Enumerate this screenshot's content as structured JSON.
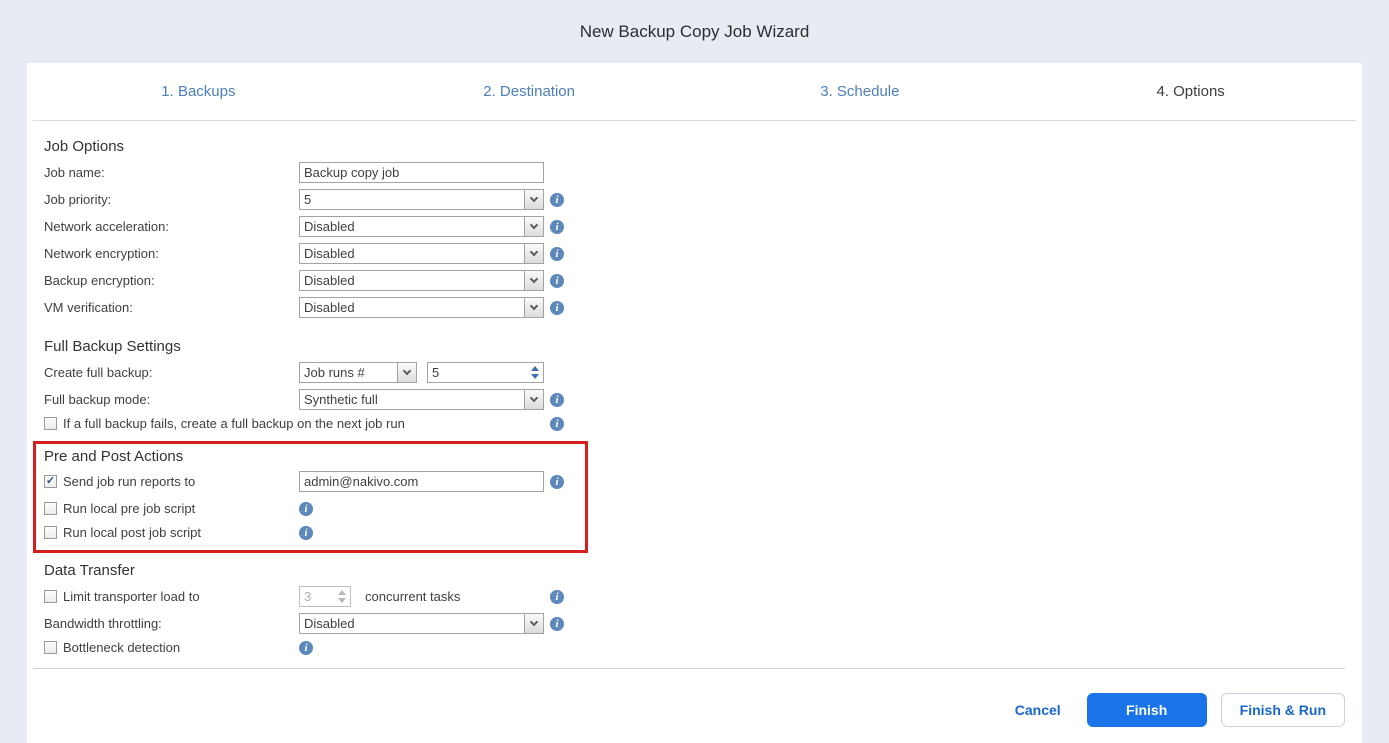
{
  "window": {
    "title": "New Backup Copy Job Wizard"
  },
  "tabs": [
    {
      "label": "1. Backups",
      "active": false
    },
    {
      "label": "2. Destination",
      "active": false
    },
    {
      "label": "3. Schedule",
      "active": false
    },
    {
      "label": "4. Options",
      "active": true
    }
  ],
  "job_options": {
    "heading": "Job Options",
    "job_name": {
      "label": "Job name:",
      "value": "Backup copy job"
    },
    "job_priority": {
      "label": "Job priority:",
      "value": "5"
    },
    "network_acceleration": {
      "label": "Network acceleration:",
      "value": "Disabled"
    },
    "network_encryption": {
      "label": "Network encryption:",
      "value": "Disabled"
    },
    "backup_encryption": {
      "label": "Backup encryption:",
      "value": "Disabled"
    },
    "vm_verification": {
      "label": "VM verification:",
      "value": "Disabled"
    }
  },
  "full_backup_settings": {
    "heading": "Full Backup Settings",
    "create_full_backup": {
      "label": "Create full backup:",
      "mode_value": "Job runs #",
      "count_value": "5"
    },
    "full_backup_mode": {
      "label": "Full backup mode:",
      "value": "Synthetic full"
    },
    "retry_checkbox": {
      "label": "If a full backup fails, create a full backup on the next job run",
      "checked": false
    }
  },
  "pre_post_actions": {
    "heading": "Pre and Post Actions",
    "highlight_color": "#d41f1f",
    "send_reports": {
      "label": "Send job run reports to",
      "checked": true,
      "value": "admin@nakivo.com"
    },
    "pre_script": {
      "label": "Run local pre job script",
      "checked": false
    },
    "post_script": {
      "label": "Run local post job script",
      "checked": false
    }
  },
  "data_transfer": {
    "heading": "Data Transfer",
    "limit_transporter": {
      "label": "Limit transporter load to",
      "checked": false,
      "value": "3",
      "suffix": "concurrent tasks",
      "disabled": true
    },
    "bandwidth_throttling": {
      "label": "Bandwidth throttling:",
      "value": "Disabled"
    },
    "bottleneck_detection": {
      "label": "Bottleneck detection",
      "checked": false
    }
  },
  "footer": {
    "cancel_label": "Cancel",
    "finish_label": "Finish",
    "finish_run_label": "Finish & Run"
  },
  "icons": {
    "info": "info-icon (white i in steel-blue circle)",
    "select_arrow": "chevron-down-icon",
    "spinner_arrows": "up-down-arrow-icons"
  },
  "colors": {
    "page_background": "#e8ebf4",
    "tab_link": "#4d7fba",
    "primary_button": "#1a73e8",
    "link_text": "#1866c9",
    "highlight_border": "#d41f1f",
    "info_icon": "#5d88bc"
  }
}
